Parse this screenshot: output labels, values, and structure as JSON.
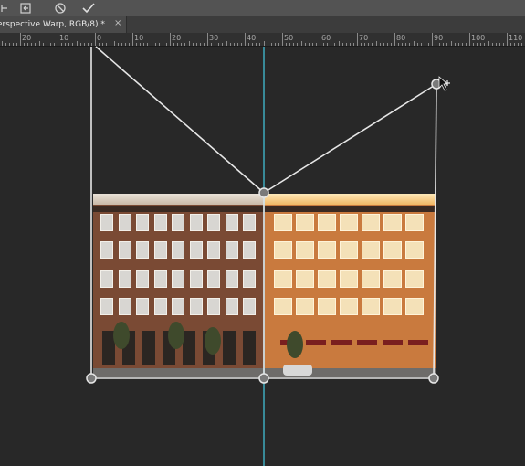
{
  "toolbar": {
    "tools": [
      {
        "name": "pin-edges",
        "icon": "pin-edges-icon"
      },
      {
        "name": "undo-warp",
        "icon": "undo-warp-icon"
      },
      {
        "name": "cancel",
        "icon": "cancel-icon"
      },
      {
        "name": "commit",
        "icon": "check-icon"
      }
    ]
  },
  "document": {
    "tab_title": "erspective Warp, RGB/8) *",
    "tab_close": "×"
  },
  "ruler": {
    "labels": [
      "20",
      "10",
      "0",
      "10",
      "20",
      "30",
      "40",
      "50",
      "60",
      "70",
      "80",
      "90",
      "100",
      "110"
    ]
  },
  "colors": {
    "guide": "#3fb3c9",
    "quad": "#e6e6e6",
    "pin_fill": "#7a7a7a"
  },
  "canvas": {
    "image": "building-facade-photo",
    "quads": 2,
    "pins": 6
  }
}
